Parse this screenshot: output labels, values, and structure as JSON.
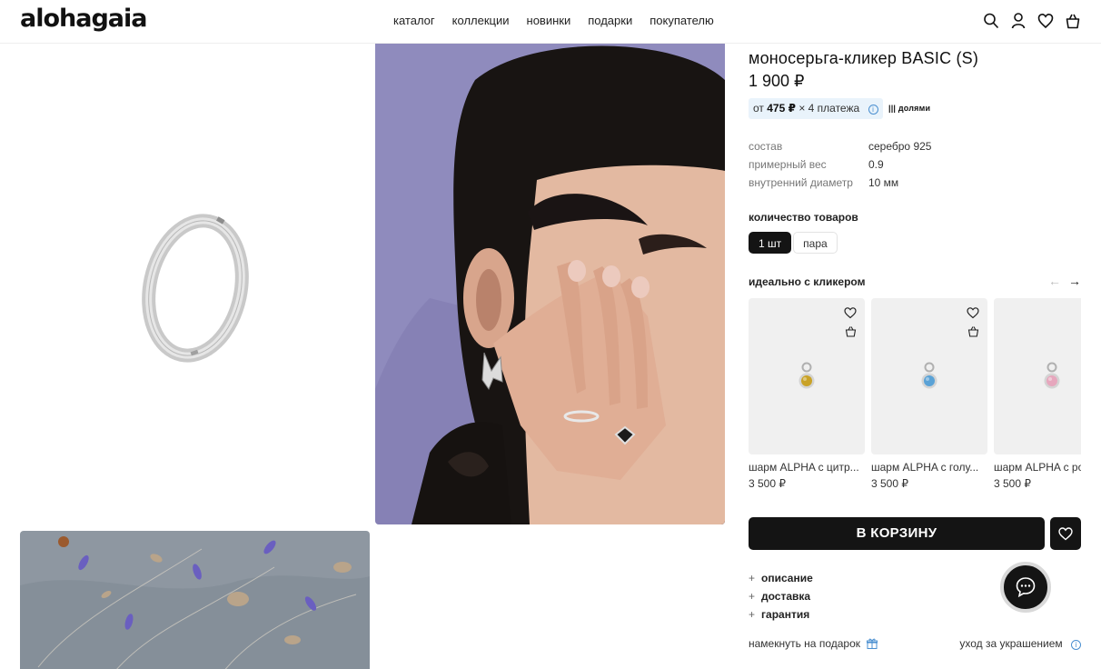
{
  "brand": {
    "logo": "alohagaia"
  },
  "nav": [
    "каталог",
    "коллекции",
    "новинки",
    "подарки",
    "покупателю"
  ],
  "header_icons": [
    "search-icon",
    "user-icon",
    "heart-icon",
    "bag-icon"
  ],
  "product": {
    "title": "моносерьга-кликер BASIC (S)",
    "price": "1 900 ₽",
    "installment": {
      "prefix": "от",
      "amount": "475 ₽",
      "suffix": "× 4 платежа",
      "provider": "долями"
    },
    "specs": [
      {
        "label": "состав",
        "value": "серебро 925"
      },
      {
        "label": "примерный вес",
        "value": "0.9"
      },
      {
        "label": "внутренний диаметр",
        "value": "10 мм"
      }
    ],
    "quantity": {
      "label": "количество товаров",
      "options": [
        "1 шт",
        "пара"
      ],
      "selected": "1 шт"
    }
  },
  "related": {
    "title": "идеально с кликером",
    "items": [
      {
        "name": "шарм ALPHA с цитр...",
        "price": "3 500 ₽",
        "stone_color": "#c9a227"
      },
      {
        "name": "шарм ALPHA с голу...",
        "price": "3 500 ₽",
        "stone_color": "#5aa2d6"
      },
      {
        "name": "шарм ALPHA с ро",
        "price": "3 500 ₽",
        "stone_color": "#e6a7bd"
      }
    ]
  },
  "actions": {
    "cart": "В КОРЗИНУ"
  },
  "accordion": [
    "описание",
    "доставка",
    "гарантия"
  ],
  "footer_links": {
    "hint": "намекнуть на подарок",
    "care": "уход за украшением"
  },
  "colors": {
    "accent": "#141414",
    "info_blue": "#4a8fd0",
    "installment_bg": "#e9f3fb"
  }
}
